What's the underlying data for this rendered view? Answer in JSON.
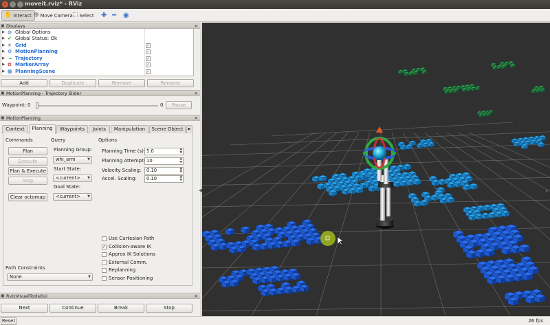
{
  "window": {
    "title": "moveit.rviz* - RViz"
  },
  "toolbar": {
    "interact": "Interact",
    "move_camera": "Move Camera",
    "select": "Select"
  },
  "displays": {
    "title": "Displays",
    "items": [
      {
        "label": "Global Options",
        "blue": false,
        "checked": null,
        "icon": "globe"
      },
      {
        "label": "Global Status: Ok",
        "blue": false,
        "checked": null,
        "icon": "check"
      },
      {
        "label": "Grid",
        "blue": true,
        "checked": true,
        "icon": "grid"
      },
      {
        "label": "MotionPlanning",
        "blue": true,
        "checked": true,
        "icon": "motion"
      },
      {
        "label": "Trajectory",
        "blue": true,
        "checked": true,
        "icon": "trajectory"
      },
      {
        "label": "MarkerArray",
        "blue": true,
        "checked": true,
        "icon": "marker"
      },
      {
        "label": "PlanningScene",
        "blue": true,
        "checked": true,
        "icon": "scene"
      }
    ],
    "buttons": {
      "add": "Add",
      "duplicate": "Duplicate",
      "remove": "Remove",
      "rename": "Rename"
    }
  },
  "trajectory_slider": {
    "title": "MotionPlanning - Trajectory Slider",
    "waypoint_label": "Waypoint:",
    "current": "0",
    "max": "0",
    "pause": "Pause"
  },
  "motion_planning": {
    "title": "MotionPlanning",
    "tabs": [
      "Context",
      "Planning",
      "Waypoints",
      "Joints",
      "Manipulation",
      "Scene Object"
    ],
    "active_tab": "Planning",
    "commands": {
      "title": "Commands",
      "plan": "Plan",
      "execute": "Execute",
      "plan_execute": "Plan & Execute",
      "stop": "Stop",
      "clear_octomap": "Clear octomap"
    },
    "query": {
      "title": "Query",
      "planning_group_label": "Planning Group:",
      "planning_group": "whi_arm",
      "start_state_label": "Start State:",
      "start_state": "<current>",
      "goal_state_label": "Goal State:",
      "goal_state": "<current>"
    },
    "options": {
      "title": "Options",
      "planning_time_label": "Planning Time (s):",
      "planning_time": "5.0",
      "planning_attempts_label": "Planning Attempts:",
      "planning_attempts": "10",
      "velocity_scaling_label": "Velocity Scaling:",
      "velocity_scaling": "0.10",
      "accel_scaling_label": "Accel. Scaling:",
      "accel_scaling": "0.10",
      "checkboxes": [
        {
          "label": "Use Cartesian Path",
          "checked": false
        },
        {
          "label": "Collision-aware IK",
          "checked": true
        },
        {
          "label": "Approx IK Solutions",
          "checked": false
        },
        {
          "label": "External Comm.",
          "checked": false
        },
        {
          "label": "Replanning",
          "checked": false
        },
        {
          "label": "Sensor Positioning",
          "checked": false
        }
      ]
    },
    "path_constraints": {
      "label": "Path Constraints",
      "value": "None"
    }
  },
  "rviz_visual_tools": {
    "title": "RvizVisualToolsGui",
    "next": "Next",
    "continue": "Continue",
    "break": "Break",
    "stop": "Stop"
  },
  "status": {
    "reset": "Reset",
    "fps": "26 fps"
  },
  "colors": {
    "voxel_blue": "#1f8fdc",
    "voxel_dark_blue": "#1a5fd0",
    "voxel_green": "#2f9a3e",
    "background": "#303030"
  }
}
